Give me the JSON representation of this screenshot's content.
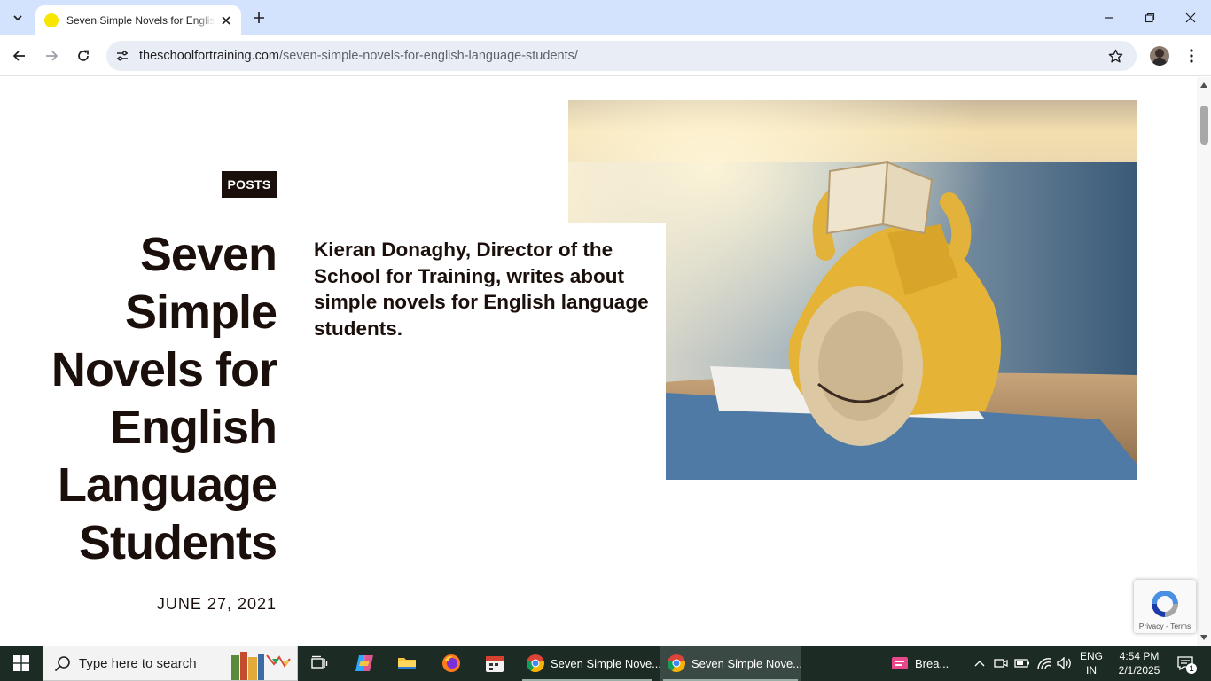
{
  "browser": {
    "tab": {
      "title": "Seven Simple Novels for English Language Students"
    },
    "address": {
      "host": "theschoolfortraining.com",
      "path": "/seven-simple-novels-for-english-language-students/"
    }
  },
  "page": {
    "category": "POSTS",
    "title_lines": [
      "Seven",
      "Simple",
      "Novels for",
      "English",
      "Language",
      "Students"
    ],
    "excerpt": "Kieran Donaghy, Director of the School for Training, writes about simple novels for English language students.",
    "date": "JUNE 27, 2021",
    "recaptcha": "Privacy - Terms"
  },
  "taskbar": {
    "search_placeholder": "Type here to search",
    "apps": [
      {
        "label": "Seven Simple Nove..."
      },
      {
        "label": "Seven Simple Nove..."
      }
    ],
    "news_label": "Brea...",
    "lang_top": "ENG",
    "lang_bottom": "IN",
    "time": "4:54 PM",
    "date": "2/1/2025",
    "notifications": "1"
  },
  "colors": {
    "tabstrip": "#d3e3fd",
    "ink": "#1b0f0c",
    "taskbar": "#1c2b24"
  }
}
